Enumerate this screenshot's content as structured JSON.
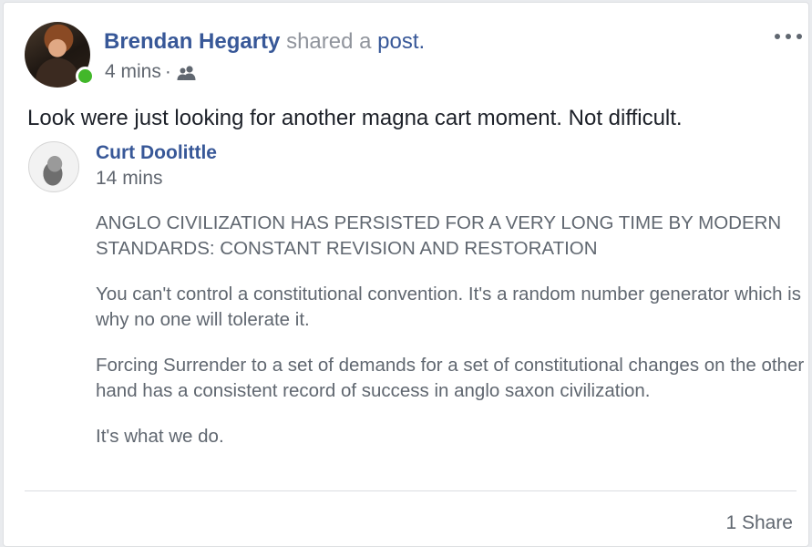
{
  "post": {
    "author_name": "Brendan Hegarty",
    "action_text": "shared a",
    "action_link": "post.",
    "timestamp": "4 mins",
    "separator": "·",
    "audience_icon": "friends-icon",
    "more_icon": "more-options-icon",
    "text": "Look were just looking for another magna cart moment. Not difficult."
  },
  "shared": {
    "author_name": "Curt Doolittle",
    "timestamp": "14 mins",
    "paragraphs": [
      "ANGLO CIVILIZATION HAS PERSISTED FOR A VERY LONG TIME BY MODERN STANDARDS: CONSTANT REVISION AND RESTORATION",
      "You can't control a constitutional convention. It's a random number generator which is why no one will tolerate it.",
      "Forcing Surrender to a set of demands for a set of constitutional changes on the other hand has a consistent record of success in anglo saxon civilization.",
      "It's what we do."
    ]
  },
  "footer": {
    "share_count": "1 Share"
  },
  "colors": {
    "link": "#385898",
    "online": "#42b72a",
    "secondary_text": "#606770",
    "primary_text": "#1d2129"
  }
}
